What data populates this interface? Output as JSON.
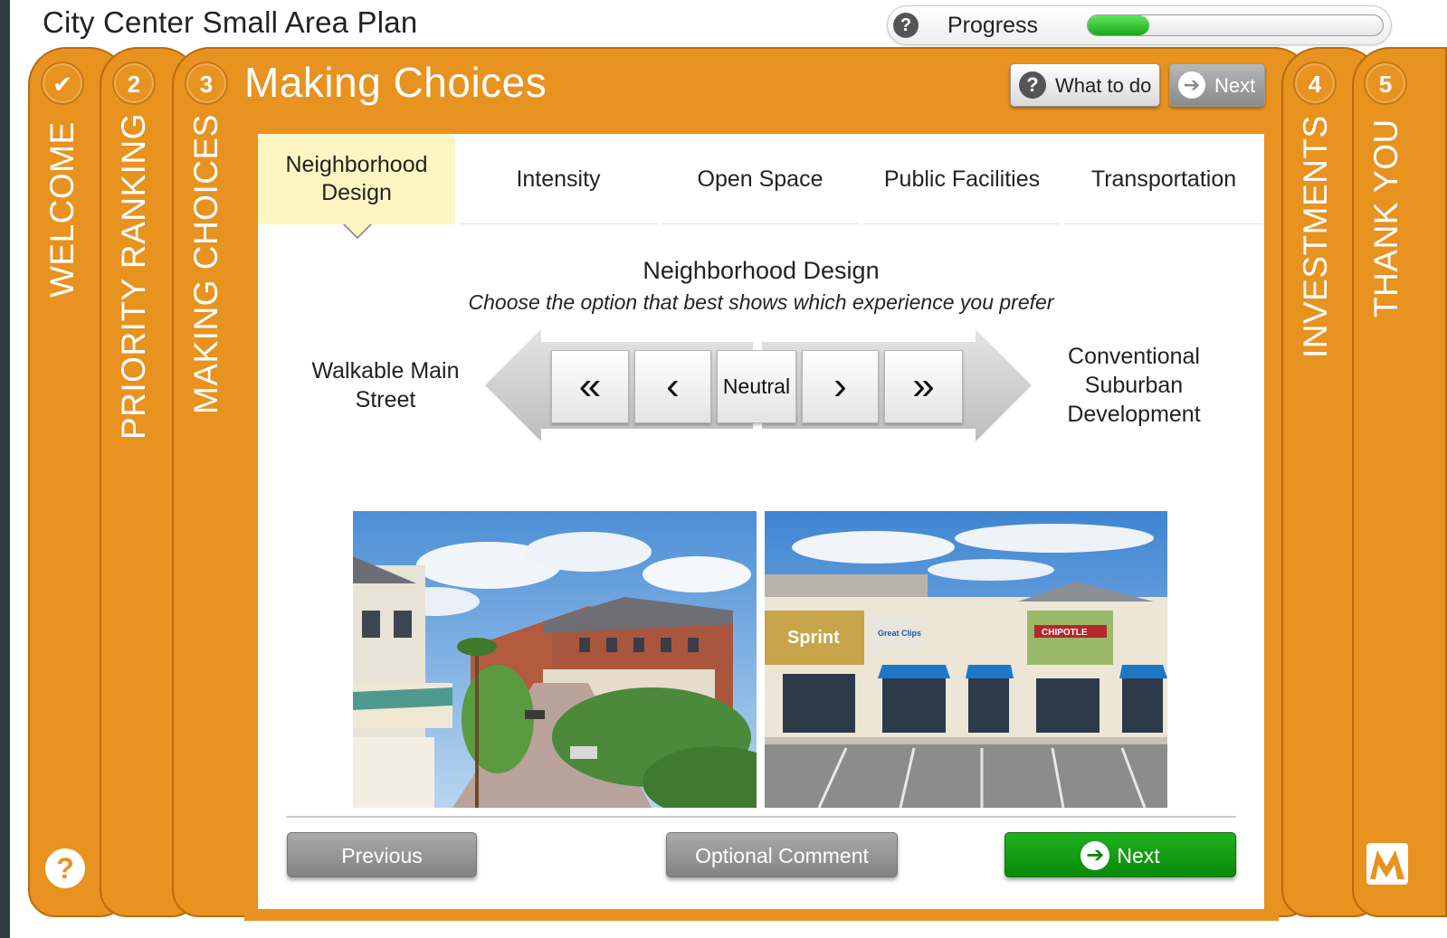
{
  "app": {
    "title": "City Center Small Area Plan",
    "progress_label": "Progress",
    "progress_fraction": 0.21
  },
  "steps": [
    {
      "badge": "✔",
      "label": "WELCOME"
    },
    {
      "badge": "2",
      "label": "PRIORITY RANKING"
    },
    {
      "badge": "3",
      "label": "MAKING CHOICES"
    },
    {
      "badge": "4",
      "label": "INVESTMENTS"
    },
    {
      "badge": "5",
      "label": "THANK YOU"
    }
  ],
  "header": {
    "title": "Making Choices",
    "what_to_do": "What to do",
    "next": "Next"
  },
  "tabs": [
    {
      "label": "Neighborhood Design",
      "active": true
    },
    {
      "label": "Intensity",
      "active": false
    },
    {
      "label": "Open Space",
      "active": false
    },
    {
      "label": "Public Facilities",
      "active": false
    },
    {
      "label": "Transportation",
      "active": false
    }
  ],
  "question": {
    "title": "Neighborhood Design",
    "subtitle": "Choose the option that best shows which experience you prefer",
    "left_label": "Walkable Main Street",
    "right_label": "Conventional Suburban Development",
    "neutral": "Neutral",
    "left_images_signs": [],
    "right_image_signs": [
      "Sprint",
      "Great Clips",
      "CHIPOTLE"
    ]
  },
  "bottom": {
    "previous": "Previous",
    "comment": "Optional Comment",
    "next": "Next"
  },
  "colors": {
    "orange": "#e8921f",
    "active_tab": "#fdf6c3",
    "green": "#0a8a0a"
  }
}
